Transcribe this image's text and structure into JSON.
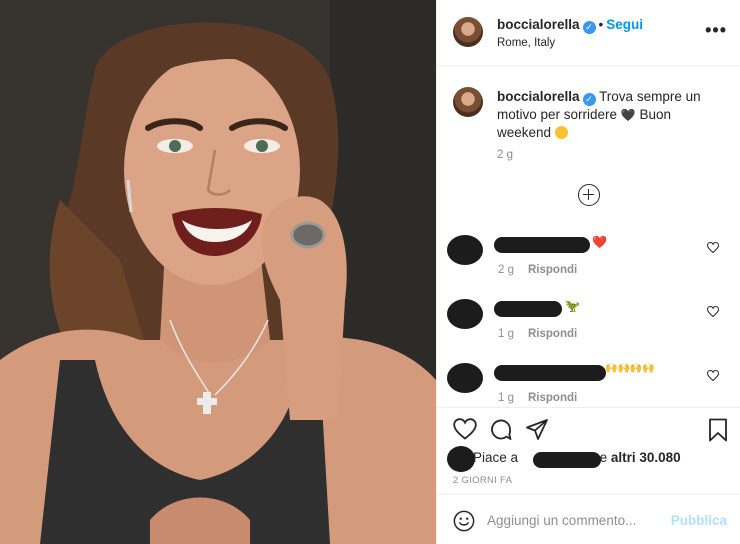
{
  "post_header": {
    "username": "boccialorella",
    "verified_icon": "verified-badge-icon",
    "separator": "•",
    "follow_label": "Segui",
    "location": "Rome, Italy",
    "more_icon": "more-options-icon"
  },
  "caption": {
    "username": "boccialorella",
    "text_part1": "Trova sempre un motivo per sorridere",
    "heart_emoji": "🖤",
    "text_part2": "Buon weekend",
    "time": "2 g"
  },
  "load_more_icon": "plus-circle-icon",
  "comments": [
    {
      "emoji": "❤️",
      "time": "2 g",
      "reply_label": "Rispondi"
    },
    {
      "emoji": "🦖",
      "time": "1 g",
      "reply_label": "Rispondi"
    },
    {
      "emoji": "🙌🙌🙌🙌",
      "time": "1 g",
      "reply_label": "Rispondi"
    }
  ],
  "actions": {
    "like_icon": "heart-icon",
    "comment_icon": "comment-icon",
    "share_icon": "paper-plane-icon",
    "save_icon": "bookmark-icon"
  },
  "likes": {
    "prefix": "Piace a",
    "suffix_connector": "e",
    "others": "altri 30.080"
  },
  "posted_ago": "2 GIORNI FA",
  "add_comment": {
    "placeholder": "Aggiungi un commento...",
    "publish_label": "Pubblica",
    "emoji_icon": "smiley-icon"
  },
  "colors": {
    "link_blue": "#0095f6",
    "verified_blue": "#3897f0",
    "publish_disabled": "#b2dffc",
    "muted_gray": "#8e8e8e",
    "border": "#efefef"
  }
}
